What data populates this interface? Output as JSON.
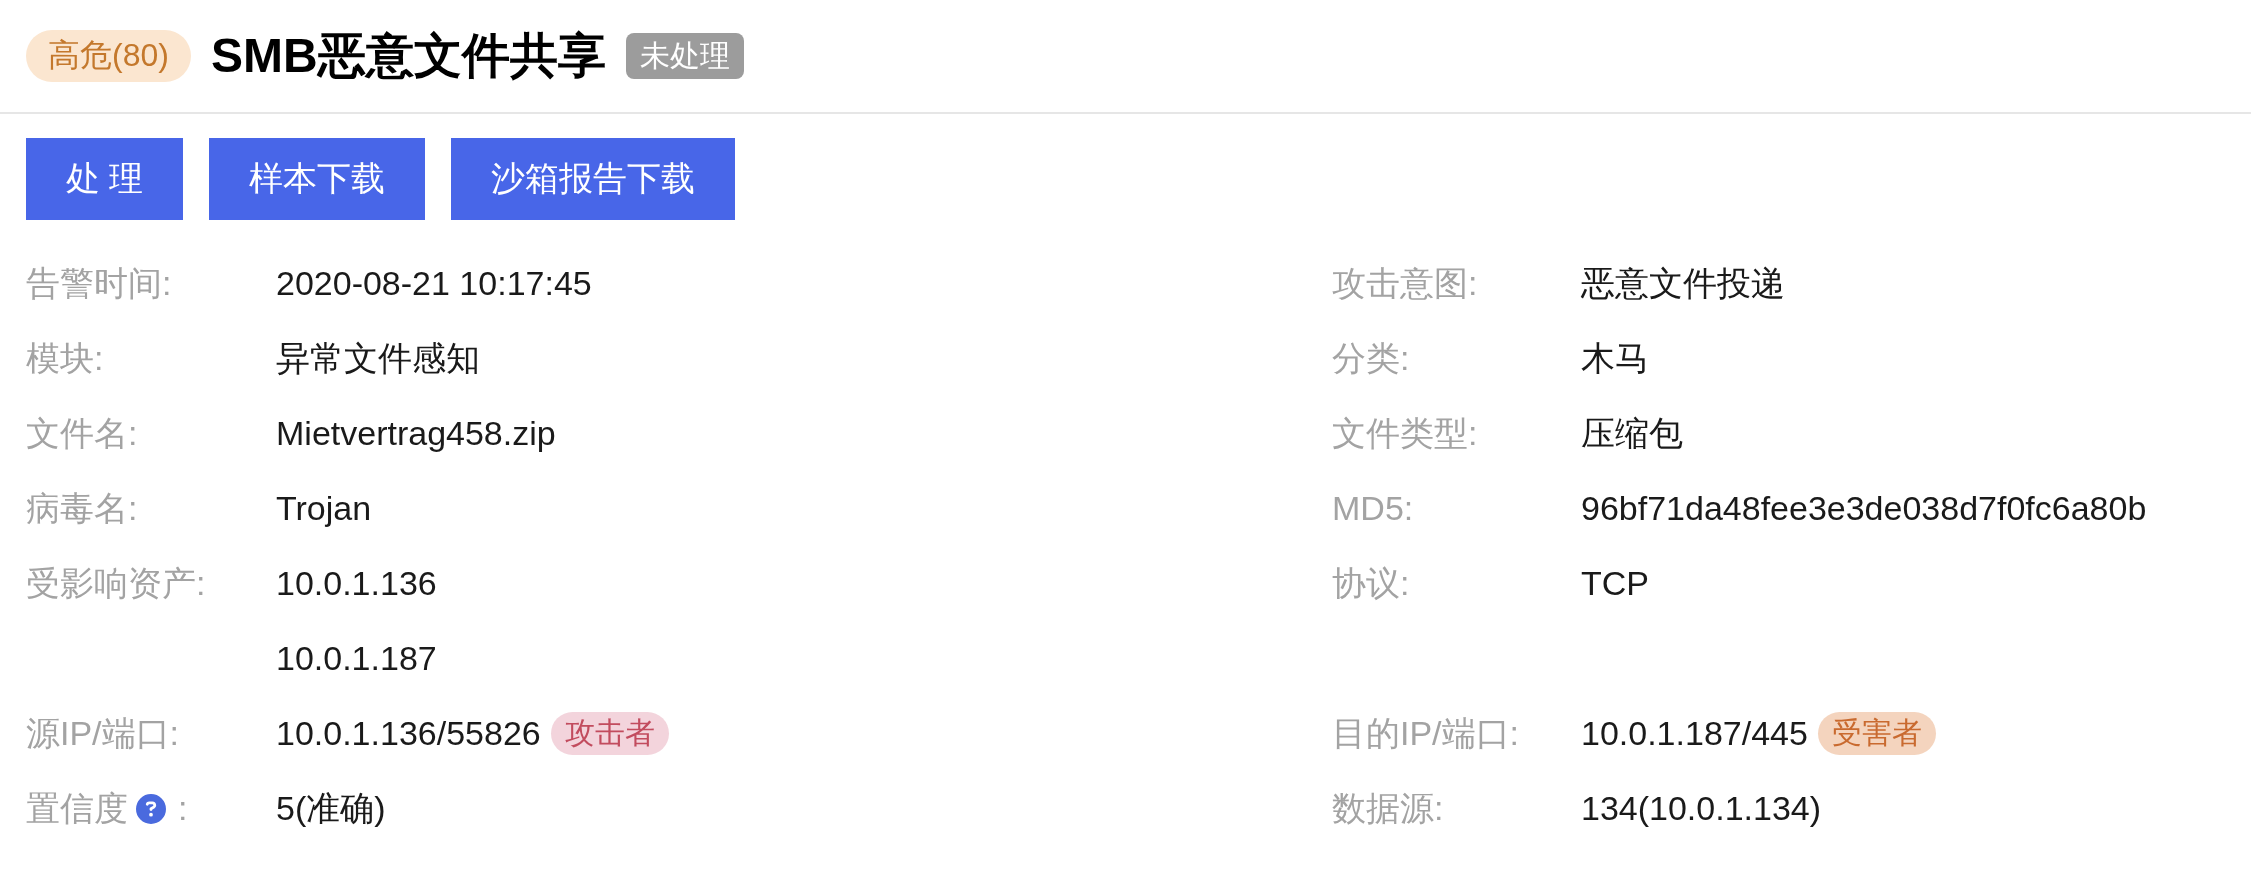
{
  "header": {
    "severity": {
      "label": "高危(80)",
      "kind": "high"
    },
    "title": "SMB恶意文件共享",
    "status": {
      "label": "未处理",
      "kind": "unprocessed"
    }
  },
  "actions": [
    {
      "label": "处 理"
    },
    {
      "label": "样本下载"
    },
    {
      "label": "沙箱报告下载"
    }
  ],
  "details": [
    {
      "left": {
        "label": "告警时间:",
        "value": "2020-08-21 10:17:45"
      },
      "right": {
        "label": "攻击意图:",
        "value": "恶意文件投递"
      }
    },
    {
      "left": {
        "label": "模块:",
        "value": "异常文件感知"
      },
      "right": {
        "label": "分类:",
        "value": "木马"
      }
    },
    {
      "left": {
        "label": "文件名:",
        "value": "Mietvertrag458.zip"
      },
      "right": {
        "label": "文件类型:",
        "value": "压缩包"
      }
    },
    {
      "left": {
        "label": "病毒名:",
        "value": "Trojan"
      },
      "right": {
        "label": "MD5:",
        "value": "96bf71da48fee3e3de038d7f0fc6a80b"
      }
    },
    {
      "left": {
        "label": "受影响资产:",
        "values": [
          "10.0.1.136",
          "10.0.1.187"
        ]
      },
      "right": {
        "label": "协议:",
        "value": "TCP"
      }
    },
    {
      "left": {
        "label": "源IP/端口:",
        "value": "10.0.1.136/55826",
        "tag": {
          "label": "攻击者",
          "kind": "attacker"
        }
      },
      "right": {
        "label": "目的IP/端口:",
        "value": "10.0.1.187/445",
        "tag": {
          "label": "受害者",
          "kind": "victim"
        }
      }
    },
    {
      "left": {
        "label": "置信度",
        "help": true,
        "label_suffix": ":",
        "value": "5(准确)"
      },
      "right": {
        "label": "数据源:",
        "value": "134(10.0.1.134)"
      }
    }
  ]
}
